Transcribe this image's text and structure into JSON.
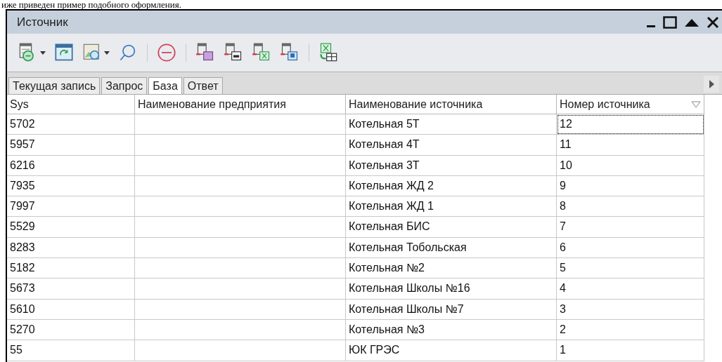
{
  "document_text": "иже приведен пример подобного оформления.",
  "window": {
    "title": "Источник"
  },
  "toolbar": [
    {
      "kind": "table-filter",
      "dropdown": true
    },
    {
      "kind": "refresh",
      "dropdown": false
    },
    {
      "kind": "image-search",
      "dropdown": true
    },
    {
      "kind": "search",
      "dropdown": false
    },
    {
      "kind": "sep"
    },
    {
      "kind": "remove",
      "dropdown": false
    },
    {
      "kind": "sep"
    },
    {
      "kind": "export-purple",
      "dropdown": false
    },
    {
      "kind": "export-print",
      "dropdown": false
    },
    {
      "kind": "export-excel",
      "dropdown": false
    },
    {
      "kind": "export-blue",
      "dropdown": false
    },
    {
      "kind": "sep"
    },
    {
      "kind": "excel-table",
      "dropdown": false
    }
  ],
  "tabs": [
    {
      "label": "Текущая запись",
      "selected": false
    },
    {
      "label": "Запрос",
      "selected": false
    },
    {
      "label": "База",
      "selected": true
    },
    {
      "label": "Ответ",
      "selected": false
    }
  ],
  "table": {
    "columns": [
      "Sys",
      "Наименование предприятия",
      "Наименование источника",
      "Номер источника"
    ],
    "rows": [
      {
        "cells": [
          "5702",
          "",
          "Котельная 5Т",
          "12"
        ],
        "focused": true
      },
      {
        "cells": [
          "5957",
          "",
          "Котельная 4Т",
          "11"
        ],
        "focused": false
      },
      {
        "cells": [
          "6216",
          "",
          "Котельная 3Т",
          "10"
        ],
        "focused": false
      },
      {
        "cells": [
          "7935",
          "",
          "Котельная ЖД 2",
          "9"
        ],
        "focused": false
      },
      {
        "cells": [
          "7997",
          "",
          "Котельная ЖД 1",
          "8"
        ],
        "focused": false
      },
      {
        "cells": [
          "5529",
          "",
          "Котельная БИС",
          "7"
        ],
        "focused": false
      },
      {
        "cells": [
          "8283",
          "",
          "Котельная Тобольская",
          "6"
        ],
        "focused": false
      },
      {
        "cells": [
          "5182",
          "",
          "Котельная №2",
          "5"
        ],
        "focused": false
      },
      {
        "cells": [
          "5673",
          "",
          "Котельная Школы №16",
          "4"
        ],
        "focused": false
      },
      {
        "cells": [
          "5610",
          "",
          "Котельная Школы №7",
          "3"
        ],
        "focused": false
      },
      {
        "cells": [
          "5270",
          "",
          "Котельная №3",
          "2"
        ],
        "focused": false
      },
      {
        "cells": [
          "55",
          "",
          "ЮК ГРЭС",
          "1"
        ],
        "focused": false
      }
    ]
  }
}
